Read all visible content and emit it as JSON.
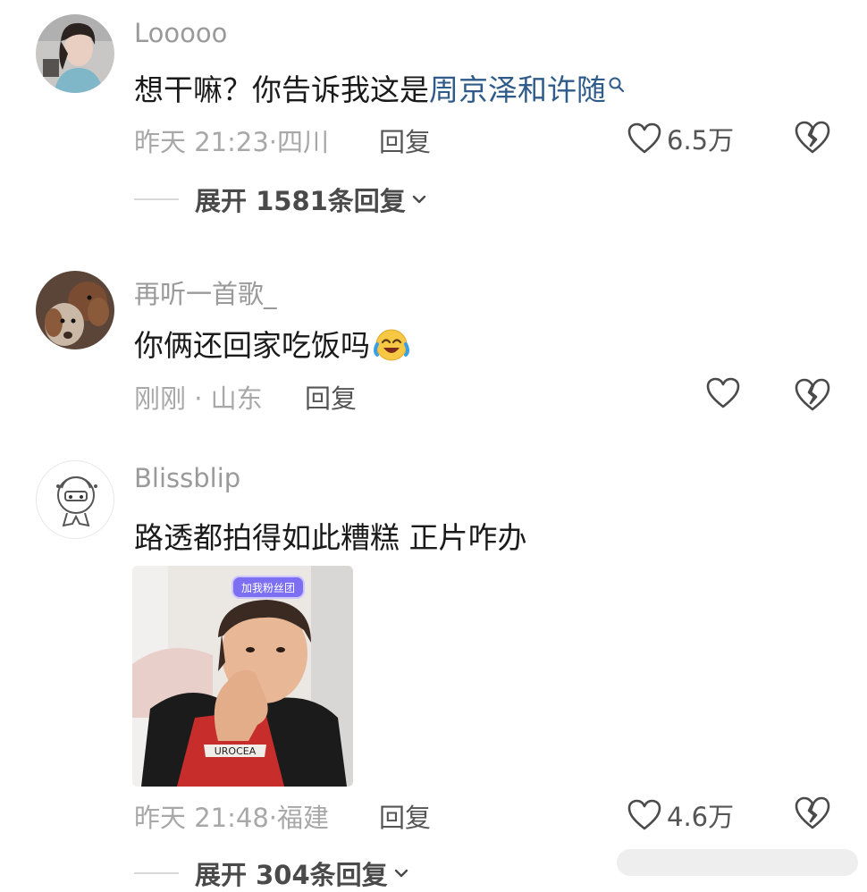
{
  "comments": [
    {
      "username": "Looooo",
      "text_prefix": "想干嘛？你告诉我这是",
      "text_link": "周京泽和许随",
      "time": "昨天 21:23",
      "location": "四川",
      "reply_label": "回复",
      "like_count": "6.5万",
      "expand_label": "展开 1581条回复"
    },
    {
      "username": "再听一首歌_",
      "text": "你俩还回家吃饭吗",
      "emoji": "laughing-crying-emoji",
      "time": "刚刚",
      "location": "山东",
      "reply_label": "回复"
    },
    {
      "username": "Blissblip",
      "text": "路透都拍得如此糟糕 正片咋办",
      "photo_sticker": "加我粉丝团",
      "shirt_text": "UROCEA",
      "time": "昨天 21:48",
      "location": "福建",
      "reply_label": "回复",
      "like_count": "4.6万",
      "expand_label": "展开 304条回复"
    }
  ],
  "icons": {
    "search": "search-icon",
    "like": "heart-outline-icon",
    "dislike": "broken-heart-icon",
    "expand": "chevron-down-icon"
  },
  "colors": {
    "link": "#2e5b8a",
    "meta": "#a8a8a8",
    "username": "#9a9a9a"
  }
}
